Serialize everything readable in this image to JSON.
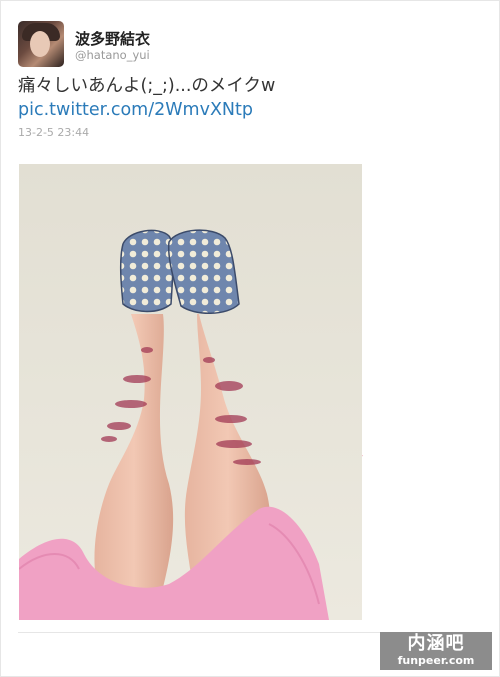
{
  "user": {
    "display_name": "波多野結衣",
    "screen_name": "@hatano_yui"
  },
  "tweet": {
    "text": "痛々しいあんよ(;_;)...のメイクw ",
    "link": "pic.twitter.com/2WmvXNtp",
    "timestamp": "13-2-5 23:44"
  },
  "photo": {
    "subject": "legs with bruise makeup and polka-dot slippers"
  },
  "watermark": {
    "main": "内涵吧",
    "sub": "funpeer.com"
  },
  "colors": {
    "link": "#2b7bb9",
    "skirt": "#f0a1c4",
    "slipper": "#6f86ad"
  }
}
